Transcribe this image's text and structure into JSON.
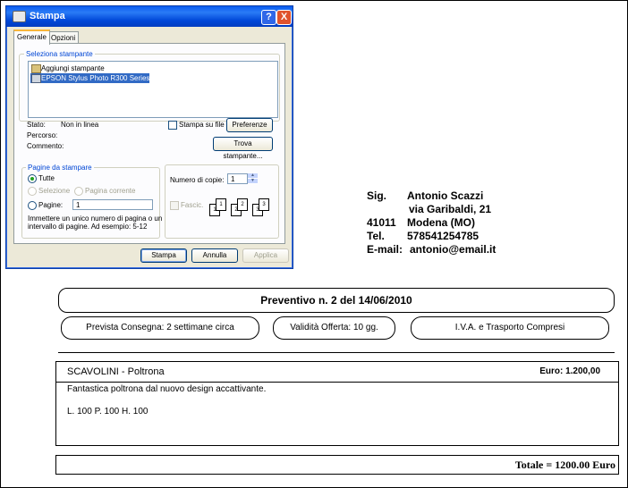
{
  "dialog": {
    "title": "Stampa",
    "help_label": "?",
    "close_label": "X",
    "tabs": [
      {
        "label": "Generale"
      },
      {
        "label": "Opzioni"
      }
    ],
    "printer_group": "Seleziona stampante",
    "printers": [
      {
        "label": "Aggiungi stampante"
      },
      {
        "label": "EPSON Stylus Photo R300 Series"
      }
    ],
    "status_label": "Stato:",
    "status_value": "Non in linea",
    "path_label": "Percorso:",
    "comment_label": "Commento:",
    "print_to_file": "Stampa su file",
    "preferences_button": "Preferenze",
    "find_printer_button": "Trova stampante...",
    "pages_group": "Pagine da stampare",
    "opt_all": "Tutte",
    "opt_selection": "Selezione",
    "opt_current": "Pagina corrente",
    "opt_pages": "Pagine:",
    "pages_value": "1",
    "pages_hint_1": "Immettere un unico numero di pagina o un",
    "pages_hint_2": "intervallo di pagine. Ad esempio: 5-12",
    "copies_label": "Numero di copie:",
    "copies_value": "1",
    "collate_label": "Fascic.",
    "collate_icons": [
      "1",
      "1",
      "2",
      "2",
      "3",
      "3"
    ],
    "print_button": "Stampa",
    "cancel_button": "Annulla",
    "apply_button": "Applica",
    "colors": {
      "titlebar": "#0a5cf0",
      "selection": "#316ac5",
      "group_label": "#0046d5"
    }
  },
  "address": {
    "salutation": "Sig.",
    "name": "Antonio Scazzi",
    "street": "via Garibaldi, 21",
    "zip": "41011",
    "city": "Modena (MO)",
    "tel_label": "Tel.",
    "tel": "578541254785",
    "email_label": "E-mail:",
    "email": "antonio@email.it"
  },
  "quote": {
    "title": "Preventivo n. 2  del 14/06/2010",
    "delivery": "Prevista Consegna: 2 settimane circa",
    "validity": "Validità Offerta: 10 gg.",
    "vat": "I.V.A. e Trasporto Compresi",
    "item_name": "SCAVOLINI - Poltrona",
    "item_price": "Euro: 1.200,00",
    "item_desc": "Fantastica poltrona dal nuovo design accattivante.",
    "item_dims": "L. 100 P. 100 H. 100",
    "total": "Totale = 1200.00 Euro"
  }
}
